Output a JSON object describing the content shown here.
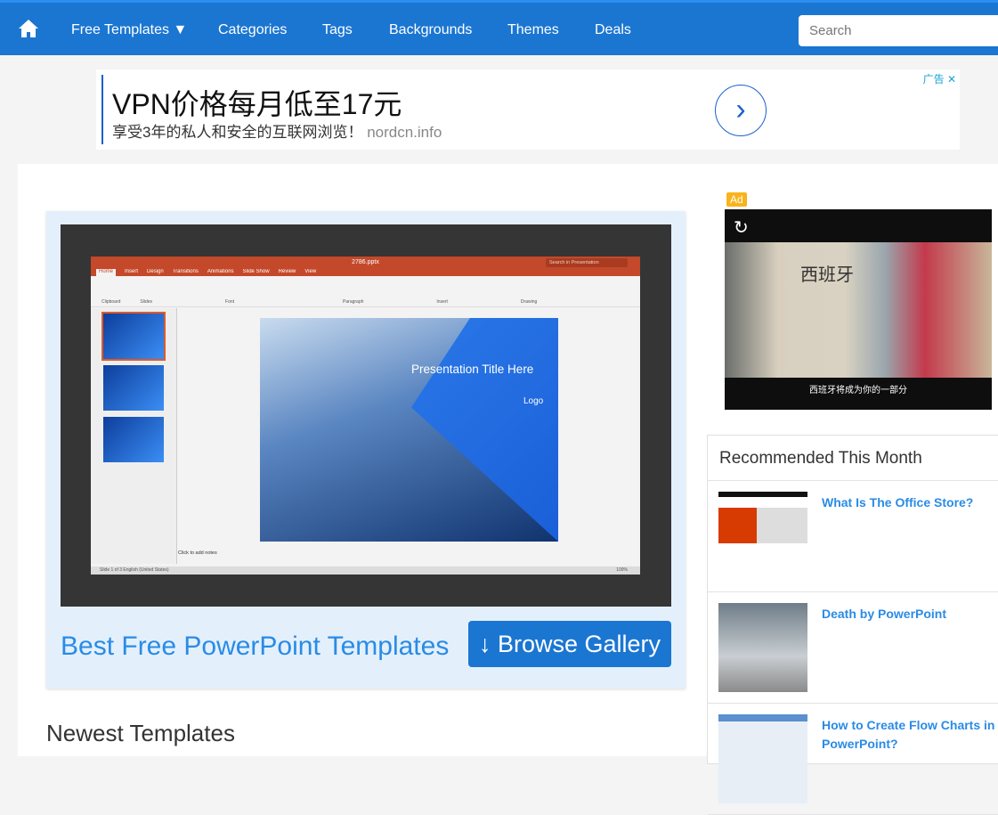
{
  "nav": {
    "home_icon": "home-icon",
    "items": [
      "Free Templates",
      "Categories",
      "Tags",
      "Backgrounds",
      "Themes",
      "Deals"
    ],
    "search_placeholder": "Search"
  },
  "top_ad": {
    "title": "VPN价格每月低至17元",
    "subtitle": "享受3年的私人和安全的互联网浏览！",
    "domain": "nordcn.info",
    "label": "广告",
    "close": "✕"
  },
  "hero": {
    "ppt": {
      "filename": "2786.pptx",
      "search": "Search in Presentation",
      "tabs": [
        "Home",
        "Insert",
        "Design",
        "Transitions",
        "Animations",
        "Slide Show",
        "Review",
        "View"
      ],
      "groups": [
        "Clipboard",
        "Slides",
        "Font",
        "Paragraph",
        "Insert",
        "Drawing"
      ],
      "slide_title": "Presentation Title Here",
      "slide_logo": "Logo",
      "notes": "Click to add notes",
      "status": "Slide 1 of 3     English (United States)",
      "zoom": "109%"
    },
    "title": "Best Free PowerPoint Templates",
    "button": "Browse Gallery"
  },
  "newest": "Newest Templates",
  "side_ad": {
    "badge": "Ad",
    "image_text": "西班牙",
    "caption": "西班牙将成为你的一部分"
  },
  "recommended": {
    "title": "Recommended This Month",
    "items": [
      {
        "title": "What Is The Office Store?"
      },
      {
        "title": "Death by PowerPoint"
      },
      {
        "title": "How to Create Flow Charts in PowerPoint?"
      }
    ]
  },
  "colors": {
    "brand": "#1b76d2",
    "link": "#2a8be6",
    "ppt": "#c4492a"
  }
}
